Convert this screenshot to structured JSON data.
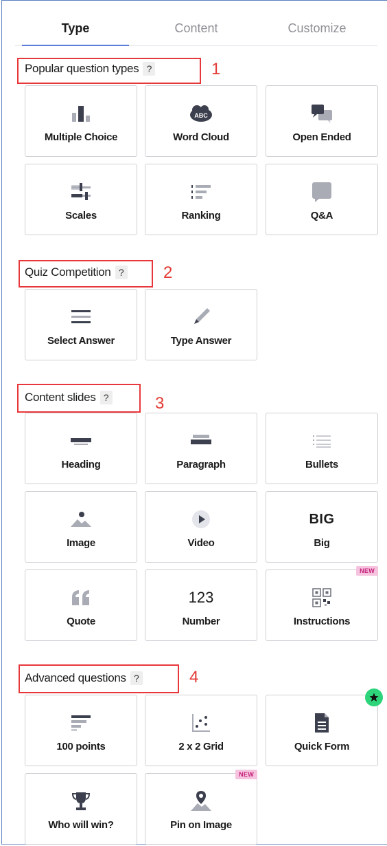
{
  "tabs": [
    {
      "label": "Type",
      "active": true
    },
    {
      "label": "Content",
      "active": false
    },
    {
      "label": "Customize",
      "active": false
    }
  ],
  "help_mark": "?",
  "sections": {
    "popular": {
      "title": "Popular question types",
      "number": "1",
      "items": [
        {
          "label": "Multiple Choice",
          "icon": "bar-chart-icon"
        },
        {
          "label": "Word Cloud",
          "icon": "word-cloud-icon"
        },
        {
          "label": "Open Ended",
          "icon": "speech-bubbles-icon"
        },
        {
          "label": "Scales",
          "icon": "sliders-icon"
        },
        {
          "label": "Ranking",
          "icon": "ranking-icon"
        },
        {
          "label": "Q&A",
          "icon": "chat-bubble-icon"
        }
      ]
    },
    "quiz": {
      "title": "Quiz Competition",
      "number": "2",
      "items": [
        {
          "label": "Select Answer",
          "icon": "lines-icon"
        },
        {
          "label": "Type Answer",
          "icon": "pencil-icon"
        }
      ]
    },
    "content": {
      "title": "Content slides",
      "number": "3",
      "items": [
        {
          "label": "Heading",
          "icon": "heading-icon"
        },
        {
          "label": "Paragraph",
          "icon": "paragraph-icon"
        },
        {
          "label": "Bullets",
          "icon": "bullets-icon"
        },
        {
          "label": "Image",
          "icon": "image-icon"
        },
        {
          "label": "Video",
          "icon": "play-icon"
        },
        {
          "label": "Big",
          "icon": "big-text-icon",
          "icon_text": "BIG"
        },
        {
          "label": "Quote",
          "icon": "quote-icon"
        },
        {
          "label": "Number",
          "icon": "number-icon",
          "icon_text": "123"
        },
        {
          "label": "Instructions",
          "icon": "qr-code-icon",
          "badge": "NEW"
        }
      ]
    },
    "advanced": {
      "title": "Advanced questions",
      "number": "4",
      "items": [
        {
          "label": "100 points",
          "icon": "points-bars-icon"
        },
        {
          "label": "2 x 2 Grid",
          "icon": "grid-scatter-icon"
        },
        {
          "label": "Quick Form",
          "icon": "document-icon",
          "badge_star": true
        },
        {
          "label": "Who will win?",
          "icon": "trophy-icon"
        },
        {
          "label": "Pin on Image",
          "icon": "map-pin-icon",
          "badge": "NEW"
        }
      ]
    }
  },
  "colors": {
    "icon_dark": "#3c3f4d",
    "icon_gray": "#a9abb5",
    "red_annotation": "#e8373b",
    "tab_underline": "#5a7bd9",
    "badge_new_bg": "#f6c3de",
    "badge_star_bg": "#2ed47a"
  }
}
